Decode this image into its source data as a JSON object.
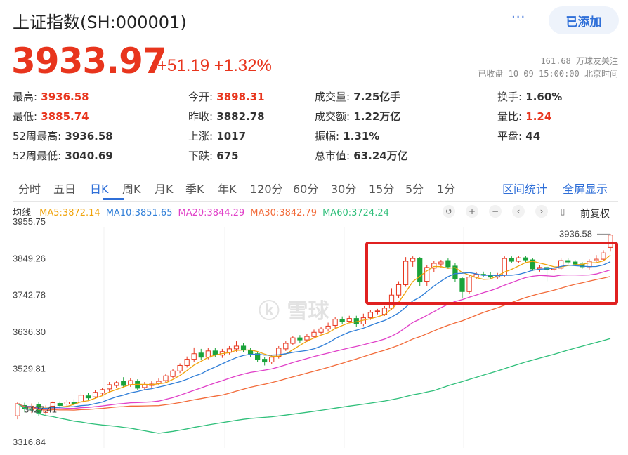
{
  "header": {
    "title": "上证指数(SH:000001)",
    "add_label": "已添加",
    "more_label": "···"
  },
  "quote": {
    "price": "3933.97",
    "change": "+51.19",
    "change_pct": "+1.32%",
    "followers": "161.68 万球友关注",
    "status_time": "已收盘 10-09 15:00:00 北京时间"
  },
  "stats": [
    {
      "label": "最高:",
      "value": "3936.58",
      "red": true
    },
    {
      "label": "今开:",
      "value": "3898.31",
      "red": true
    },
    {
      "label": "成交量:",
      "value": "7.25亿手",
      "red": false
    },
    {
      "label": "换手:",
      "value": "1.60%",
      "red": false
    },
    {
      "label": "最低:",
      "value": "3885.74",
      "red": true
    },
    {
      "label": "昨收:",
      "value": "3882.78",
      "red": false
    },
    {
      "label": "成交额:",
      "value": "1.22万亿",
      "red": false
    },
    {
      "label": "量比:",
      "value": "1.24",
      "red": true
    },
    {
      "label": "52周最高:",
      "value": "3936.58",
      "red": false
    },
    {
      "label": "上涨:",
      "value": "1017",
      "red": false
    },
    {
      "label": "振幅:",
      "value": "1.31%",
      "red": false
    },
    {
      "label": "平盘:",
      "value": "44",
      "red": false
    },
    {
      "label": "52周最低:",
      "value": "3040.69",
      "red": false
    },
    {
      "label": "下跌:",
      "value": "675",
      "red": false
    },
    {
      "label": "总市值:",
      "value": "63.24万亿",
      "red": false
    }
  ],
  "tabs": [
    "分时",
    "五日",
    "日K",
    "周K",
    "月K",
    "季K",
    "年K",
    "120分",
    "60分",
    "30分",
    "15分",
    "5分",
    "1分"
  ],
  "active_tab": 2,
  "tab_actions": [
    "区间统计",
    "全屏显示"
  ],
  "ma_legend": {
    "title": "均线",
    "items": [
      {
        "text": "MA5:3872.14",
        "color": "#f0a30a"
      },
      {
        "text": "MA10:3851.65",
        "color": "#2f7ed8"
      },
      {
        "text": "MA20:3844.29",
        "color": "#e040c8"
      },
      {
        "text": "MA30:3842.79",
        "color": "#f26b3a"
      },
      {
        "text": "MA60:3724.24",
        "color": "#2fbf7a"
      }
    ]
  },
  "toolbar": {
    "icons": [
      "undo-icon",
      "zoom-in-icon",
      "zoom-out-icon",
      "prev-icon",
      "next-icon",
      "candle-icon"
    ],
    "adjust_label": "前复权"
  },
  "colors": {
    "up": "#e8351d",
    "down": "#1aa33a",
    "accent": "#2f6fd8",
    "highlight_box": "#e02020"
  },
  "chart_data": {
    "type": "candlestick",
    "y_ticks": [
      "3955.75",
      "3849.26",
      "3742.78",
      "3636.30",
      "3529.81",
      "3316.84"
    ],
    "ylim": [
      3316.84,
      3955.75
    ],
    "high_label": "3936.58",
    "low_label": "3427.41",
    "candles": [
      {
        "o": 3410,
        "c": 3445,
        "h": 3450,
        "l": 3400
      },
      {
        "o": 3440,
        "c": 3430,
        "h": 3448,
        "l": 3420
      },
      {
        "o": 3428,
        "c": 3438,
        "h": 3446,
        "l": 3418
      },
      {
        "o": 3442,
        "c": 3418,
        "h": 3450,
        "l": 3410
      },
      {
        "o": 3420,
        "c": 3432,
        "h": 3440,
        "l": 3412
      },
      {
        "o": 3438,
        "c": 3448,
        "h": 3452,
        "l": 3430
      },
      {
        "o": 3446,
        "c": 3440,
        "h": 3452,
        "l": 3432
      },
      {
        "o": 3444,
        "c": 3450,
        "h": 3456,
        "l": 3436
      },
      {
        "o": 3448,
        "c": 3446,
        "h": 3458,
        "l": 3440
      },
      {
        "o": 3450,
        "c": 3470,
        "h": 3478,
        "l": 3446
      },
      {
        "o": 3468,
        "c": 3462,
        "h": 3476,
        "l": 3456
      },
      {
        "o": 3465,
        "c": 3478,
        "h": 3484,
        "l": 3460
      },
      {
        "o": 3476,
        "c": 3486,
        "h": 3490,
        "l": 3470
      },
      {
        "o": 3488,
        "c": 3500,
        "h": 3508,
        "l": 3480
      },
      {
        "o": 3498,
        "c": 3506,
        "h": 3512,
        "l": 3490
      },
      {
        "o": 3510,
        "c": 3498,
        "h": 3522,
        "l": 3492
      },
      {
        "o": 3500,
        "c": 3512,
        "h": 3520,
        "l": 3494
      },
      {
        "o": 3510,
        "c": 3490,
        "h": 3516,
        "l": 3484
      },
      {
        "o": 3492,
        "c": 3500,
        "h": 3508,
        "l": 3486
      },
      {
        "o": 3498,
        "c": 3502,
        "h": 3510,
        "l": 3490
      },
      {
        "o": 3504,
        "c": 3510,
        "h": 3518,
        "l": 3498
      },
      {
        "o": 3512,
        "c": 3526,
        "h": 3532,
        "l": 3506
      },
      {
        "o": 3524,
        "c": 3540,
        "h": 3546,
        "l": 3518
      },
      {
        "o": 3540,
        "c": 3556,
        "h": 3562,
        "l": 3534
      },
      {
        "o": 3556,
        "c": 3574,
        "h": 3582,
        "l": 3550
      },
      {
        "o": 3574,
        "c": 3590,
        "h": 3608,
        "l": 3566
      },
      {
        "o": 3592,
        "c": 3580,
        "h": 3604,
        "l": 3572
      },
      {
        "o": 3580,
        "c": 3598,
        "h": 3606,
        "l": 3574
      },
      {
        "o": 3598,
        "c": 3588,
        "h": 3606,
        "l": 3580
      },
      {
        "o": 3586,
        "c": 3596,
        "h": 3604,
        "l": 3578
      },
      {
        "o": 3594,
        "c": 3604,
        "h": 3612,
        "l": 3588
      },
      {
        "o": 3604,
        "c": 3612,
        "h": 3626,
        "l": 3596
      },
      {
        "o": 3612,
        "c": 3602,
        "h": 3620,
        "l": 3594
      },
      {
        "o": 3600,
        "c": 3590,
        "h": 3606,
        "l": 3580
      },
      {
        "o": 3590,
        "c": 3574,
        "h": 3596,
        "l": 3566
      },
      {
        "o": 3574,
        "c": 3566,
        "h": 3580,
        "l": 3556
      },
      {
        "o": 3566,
        "c": 3580,
        "h": 3586,
        "l": 3560
      },
      {
        "o": 3582,
        "c": 3606,
        "h": 3612,
        "l": 3576
      },
      {
        "o": 3604,
        "c": 3620,
        "h": 3626,
        "l": 3598
      },
      {
        "o": 3620,
        "c": 3636,
        "h": 3642,
        "l": 3614
      },
      {
        "o": 3636,
        "c": 3630,
        "h": 3644,
        "l": 3622
      },
      {
        "o": 3630,
        "c": 3640,
        "h": 3648,
        "l": 3624
      },
      {
        "o": 3640,
        "c": 3652,
        "h": 3660,
        "l": 3634
      },
      {
        "o": 3652,
        "c": 3662,
        "h": 3668,
        "l": 3646
      },
      {
        "o": 3662,
        "c": 3670,
        "h": 3680,
        "l": 3654
      },
      {
        "o": 3672,
        "c": 3690,
        "h": 3696,
        "l": 3664
      },
      {
        "o": 3690,
        "c": 3684,
        "h": 3698,
        "l": 3676
      },
      {
        "o": 3684,
        "c": 3692,
        "h": 3700,
        "l": 3678
      },
      {
        "o": 3692,
        "c": 3676,
        "h": 3700,
        "l": 3668
      },
      {
        "o": 3676,
        "c": 3694,
        "h": 3706,
        "l": 3670
      },
      {
        "o": 3694,
        "c": 3710,
        "h": 3716,
        "l": 3688
      },
      {
        "o": 3712,
        "c": 3714,
        "h": 3720,
        "l": 3704
      },
      {
        "o": 3704,
        "c": 3722,
        "h": 3728,
        "l": 3700
      },
      {
        "o": 3722,
        "c": 3760,
        "h": 3780,
        "l": 3716
      },
      {
        "o": 3760,
        "c": 3790,
        "h": 3800,
        "l": 3752
      },
      {
        "o": 3790,
        "c": 3858,
        "h": 3870,
        "l": 3784
      },
      {
        "o": 3858,
        "c": 3866,
        "h": 3872,
        "l": 3842
      },
      {
        "o": 3866,
        "c": 3798,
        "h": 3870,
        "l": 3786
      },
      {
        "o": 3800,
        "c": 3840,
        "h": 3846,
        "l": 3786
      },
      {
        "o": 3838,
        "c": 3852,
        "h": 3860,
        "l": 3826
      },
      {
        "o": 3850,
        "c": 3856,
        "h": 3862,
        "l": 3840
      },
      {
        "o": 3860,
        "c": 3842,
        "h": 3866,
        "l": 3836
      },
      {
        "o": 3844,
        "c": 3808,
        "h": 3854,
        "l": 3798
      },
      {
        "o": 3808,
        "c": 3770,
        "h": 3812,
        "l": 3750
      },
      {
        "o": 3770,
        "c": 3812,
        "h": 3818,
        "l": 3764
      },
      {
        "o": 3812,
        "c": 3820,
        "h": 3826,
        "l": 3806
      },
      {
        "o": 3820,
        "c": 3818,
        "h": 3828,
        "l": 3812
      },
      {
        "o": 3818,
        "c": 3812,
        "h": 3826,
        "l": 3806
      },
      {
        "o": 3812,
        "c": 3818,
        "h": 3824,
        "l": 3806
      },
      {
        "o": 3818,
        "c": 3866,
        "h": 3872,
        "l": 3812
      },
      {
        "o": 3866,
        "c": 3858,
        "h": 3872,
        "l": 3852
      },
      {
        "o": 3858,
        "c": 3868,
        "h": 3874,
        "l": 3852
      },
      {
        "o": 3868,
        "c": 3862,
        "h": 3874,
        "l": 3856
      },
      {
        "o": 3862,
        "c": 3836,
        "h": 3866,
        "l": 3830
      },
      {
        "o": 3836,
        "c": 3840,
        "h": 3846,
        "l": 3828
      },
      {
        "o": 3840,
        "c": 3834,
        "h": 3846,
        "l": 3800
      },
      {
        "o": 3834,
        "c": 3838,
        "h": 3844,
        "l": 3828
      },
      {
        "o": 3838,
        "c": 3860,
        "h": 3866,
        "l": 3832
      },
      {
        "o": 3860,
        "c": 3856,
        "h": 3866,
        "l": 3850
      },
      {
        "o": 3856,
        "c": 3850,
        "h": 3862,
        "l": 3844
      },
      {
        "o": 3850,
        "c": 3842,
        "h": 3856,
        "l": 3836
      },
      {
        "o": 3842,
        "c": 3858,
        "h": 3864,
        "l": 3834
      },
      {
        "o": 3860,
        "c": 3864,
        "h": 3876,
        "l": 3856
      },
      {
        "o": 3864,
        "c": 3882,
        "h": 3890,
        "l": 3858
      },
      {
        "o": 3898,
        "c": 3934,
        "h": 3937,
        "l": 3886
      }
    ]
  }
}
